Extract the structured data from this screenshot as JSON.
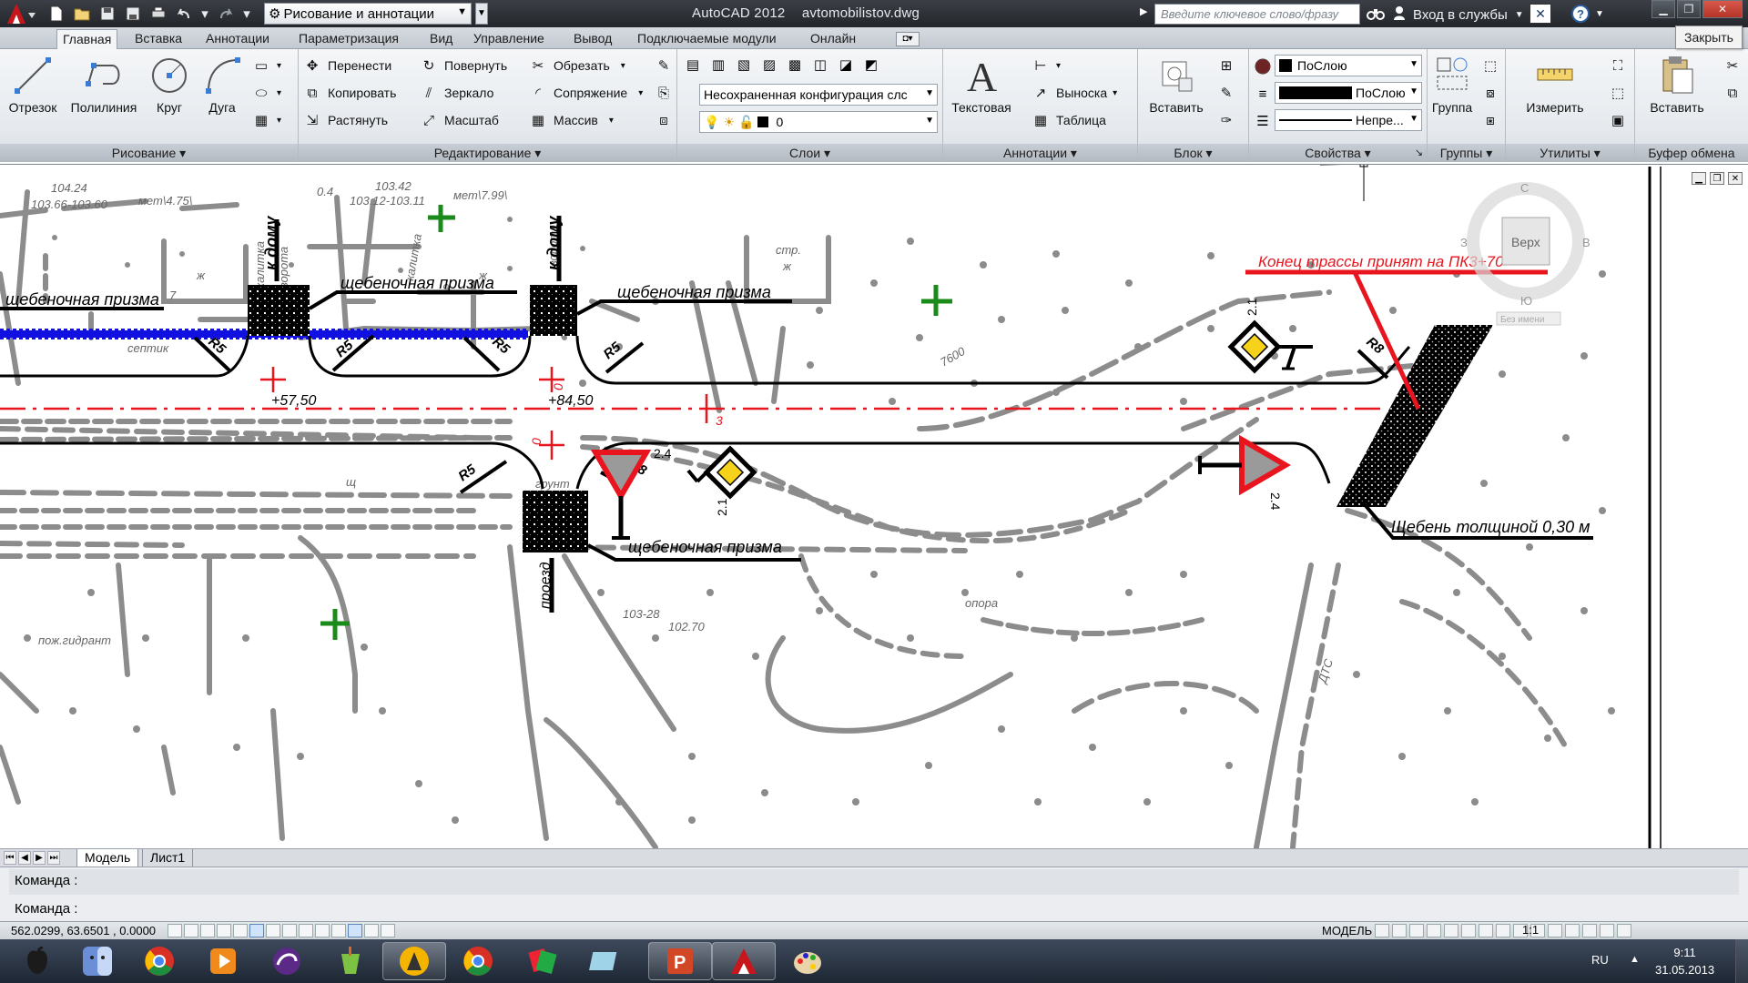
{
  "titlebar": {
    "workspace": "Рисование и аннотации",
    "app_name": "AutoCAD 2012",
    "file_name": "avtomobilistov.dwg",
    "search_placeholder": "Введите ключевое слово/фразу",
    "login_label": "Вход в службы",
    "close_tooltip": "Закрыть"
  },
  "tabs": [
    "Главная",
    "Вставка",
    "Аннотации",
    "Параметризация",
    "Вид",
    "Управление",
    "Вывод",
    "Подключаемые модули",
    "Онлайн"
  ],
  "ribbon": {
    "draw": {
      "title": "Рисование",
      "line": "Отрезок",
      "polyline": "Полилиния",
      "circle": "Круг",
      "arc": "Дуга"
    },
    "modify": {
      "title": "Редактирование",
      "move": "Перенести",
      "copy": "Копировать",
      "stretch": "Растянуть",
      "rotate": "Повернуть",
      "mirror": "Зеркало",
      "scale": "Масштаб",
      "trim": "Обрезать",
      "fillet": "Сопряжение",
      "array": "Массив"
    },
    "layers": {
      "title": "Слои",
      "state": "Несохраненная конфигурация слс",
      "current": "0"
    },
    "annotation": {
      "title": "Аннотации",
      "text": "Текстовая",
      "leader": "Выноска",
      "table": "Таблица"
    },
    "block": {
      "title": "Блок",
      "insert": "Вставить"
    },
    "properties": {
      "title": "Свойства",
      "color": "ПоСлою",
      "lineweight": "ПоСлою",
      "linetype": "Непре..."
    },
    "groups": {
      "title": "Группы",
      "group": "Группа"
    },
    "utilities": {
      "title": "Утилиты",
      "measure": "Измерить"
    },
    "clipboard": {
      "title": "Буфер обмена",
      "paste": "Вставить"
    }
  },
  "viewcube": {
    "face": "Верх",
    "north": "С",
    "south": "Ю",
    "west": "З",
    "east": "В",
    "ucs": "Без имени"
  },
  "drawing_labels": {
    "el1": "104.24",
    "el1b": "103.66-103.60",
    "met1": "мет\\4.75\\",
    "el2": "0.4",
    "el3": "103.42",
    "el3b": "103.12-103.11",
    "met2": "мет\\7.99\\",
    "zh1": "ж",
    "zh2": "ж",
    "seven": "7",
    "nine": "9",
    "str": "стр.",
    "zh3": "ж",
    "kalitka1": "калитка",
    "vorota1": "ворота",
    "kalitka2": "калитка",
    "vorota2": "ворота",
    "k_domu1": "к дому",
    "k_domu2": "к дому",
    "shch1": "щебеночная призма",
    "shch2": "щебеночная призма",
    "shch3": "щебеночная призма",
    "shch4": "щебеночная призма",
    "septik": "септик",
    "r5_1": "R5",
    "r5_2": "R5",
    "r5_3": "R5",
    "r5_4": "R5",
    "r5_5": "R5",
    "r8_1": "R8",
    "r8_2": "R8",
    "ch1": "+57,50",
    "ch2": "+84,50",
    "pk3": "3",
    "shch_mark": "щ",
    "grunt": "грунт",
    "end_route": "Конец трассы принят на ПК3+70",
    "shcheben": "Щебень толщиной 0,30 м",
    "sign21a": "2.1",
    "sign21b": "2.1",
    "sign24a": "2.4",
    "sign24b": "2.4",
    "pozh": "пож.гидрант",
    "proezd": "проезд",
    "dts": "ДТС",
    "mark_102": "102.70",
    "mark_103": "103-28",
    "opora": "опора",
    "num_7600": "7600",
    "zero1": "0",
    "zero2": "0"
  },
  "layout_tabs": [
    "Модель",
    "Лист1"
  ],
  "command": {
    "history": "Команда :",
    "prompt": "Команда :"
  },
  "status": {
    "coords": "562.0299, 63.6501 , 0.0000",
    "model": "МОДЕЛЬ",
    "scale": "1:1"
  },
  "taskbar": {
    "lang": "RU",
    "time": "9:11",
    "date": "31.05.2013"
  }
}
